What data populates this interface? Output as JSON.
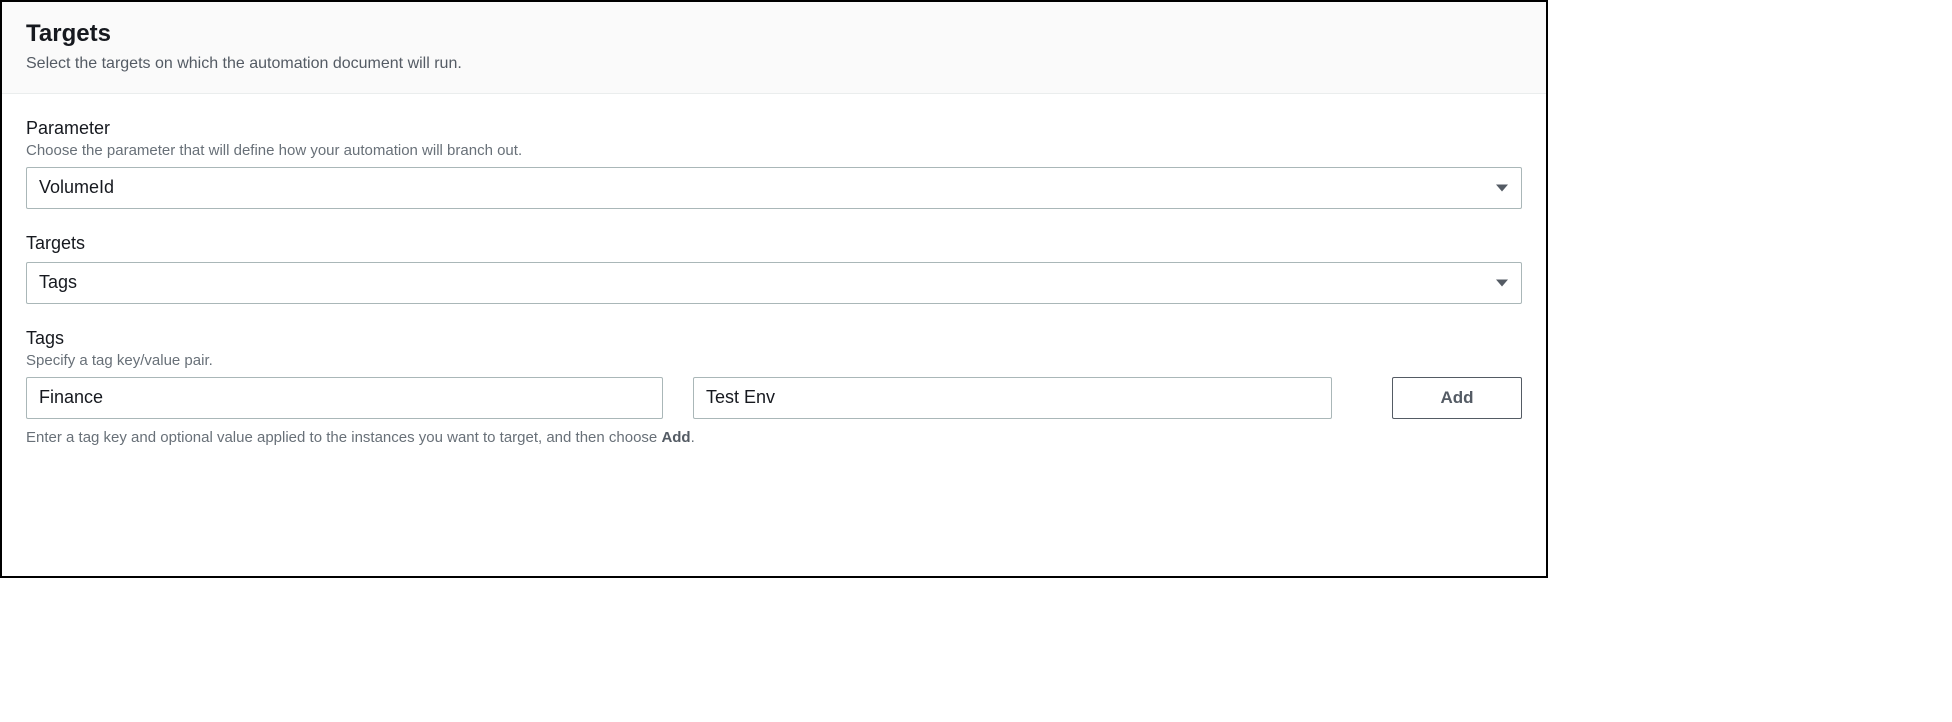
{
  "header": {
    "title": "Targets",
    "subtitle": "Select the targets on which the automation document will run."
  },
  "parameter": {
    "label": "Parameter",
    "hint": "Choose the parameter that will define how your automation will branch out.",
    "value": "VolumeId"
  },
  "targets": {
    "label": "Targets",
    "value": "Tags"
  },
  "tags": {
    "label": "Tags",
    "hint": "Specify a tag key/value pair.",
    "key_value": "Finance",
    "value_value": "Test Env",
    "add_label": "Add",
    "help_prefix": "Enter a tag key and optional value applied to the instances you want to target, and then choose ",
    "help_bold": "Add",
    "help_suffix": "."
  }
}
